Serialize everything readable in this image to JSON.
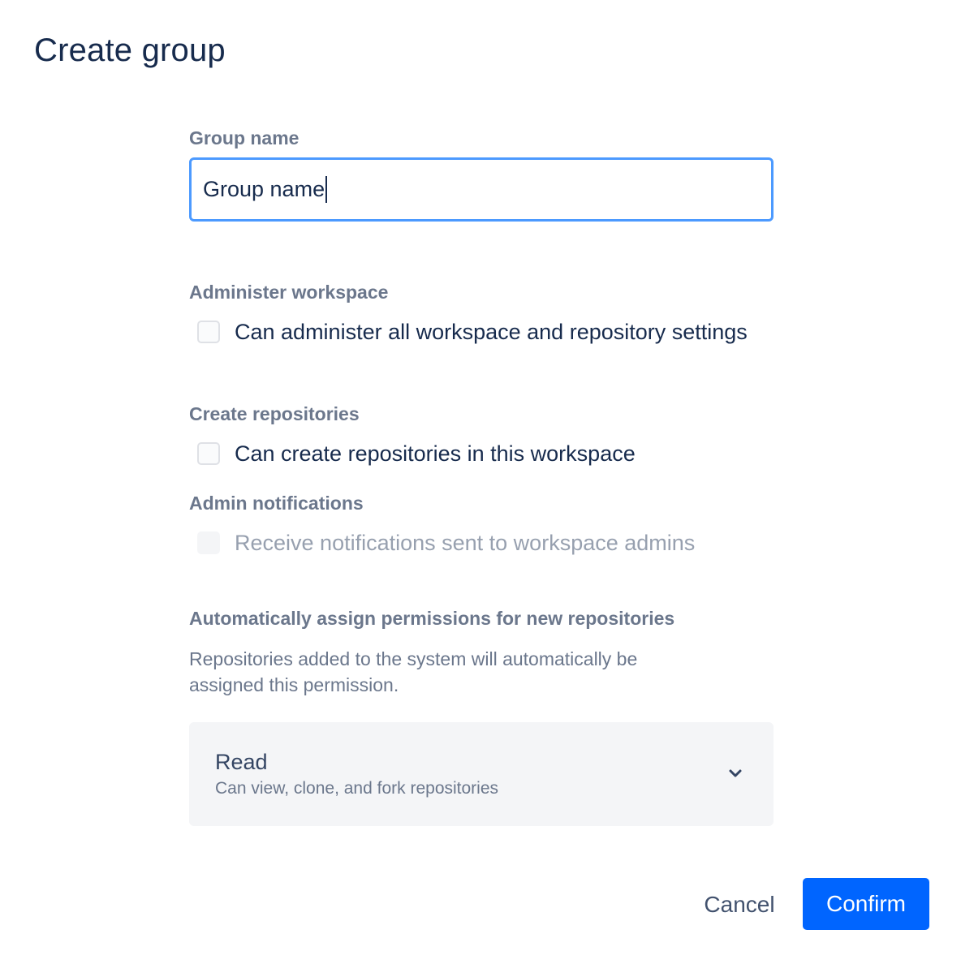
{
  "dialog": {
    "title": "Create group"
  },
  "group_name": {
    "label": "Group name",
    "value": "Group name"
  },
  "administer_workspace": {
    "label": "Administer workspace",
    "checkbox_label": "Can administer all workspace and repository settings",
    "checked": false
  },
  "create_repositories": {
    "label": "Create repositories",
    "checkbox_label": "Can create repositories in this workspace",
    "checked": false
  },
  "admin_notifications": {
    "label": "Admin notifications",
    "checkbox_label": "Receive notifications sent to workspace admins",
    "checked": false,
    "disabled": true
  },
  "auto_permissions": {
    "label": "Automatically assign permissions for new repositories",
    "help": "Repositories added to the system will automatically be assigned this permission.",
    "selected": {
      "title": "Read",
      "description": "Can view, clone, and fork repositories"
    },
    "icon": "chevron-down-icon"
  },
  "actions": {
    "cancel_label": "Cancel",
    "confirm_label": "Confirm"
  },
  "colors": {
    "primary": "#0065ff",
    "focus_border": "#4c9aff",
    "text": "#172b4d",
    "subtle_text": "#6b778c",
    "disabled_text": "#97a0af"
  }
}
